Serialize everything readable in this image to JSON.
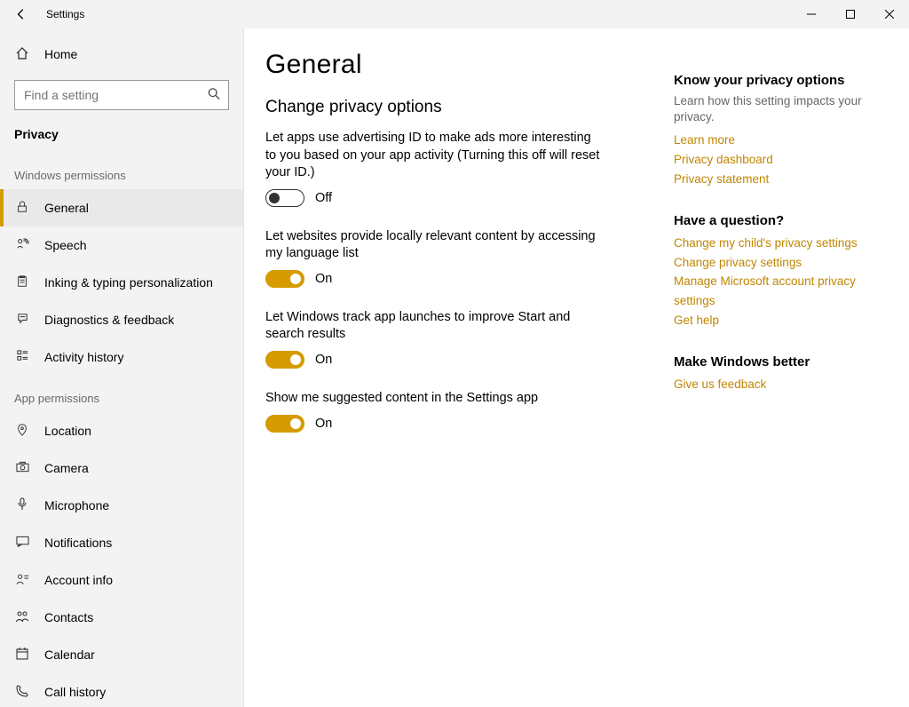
{
  "titlebar": {
    "title": "Settings"
  },
  "sidebar": {
    "home": "Home",
    "search_placeholder": "Find a setting",
    "category": "Privacy",
    "section_win": "Windows permissions",
    "section_app": "App permissions",
    "items_win": [
      {
        "icon": "lock",
        "label": "General"
      },
      {
        "icon": "speech",
        "label": "Speech"
      },
      {
        "icon": "ink",
        "label": "Inking & typing personalization"
      },
      {
        "icon": "diag",
        "label": "Diagnostics & feedback"
      },
      {
        "icon": "history",
        "label": "Activity history"
      }
    ],
    "items_app": [
      {
        "icon": "location",
        "label": "Location"
      },
      {
        "icon": "camera",
        "label": "Camera"
      },
      {
        "icon": "mic",
        "label": "Microphone"
      },
      {
        "icon": "notif",
        "label": "Notifications"
      },
      {
        "icon": "account",
        "label": "Account info"
      },
      {
        "icon": "contacts",
        "label": "Contacts"
      },
      {
        "icon": "calendar",
        "label": "Calendar"
      },
      {
        "icon": "call",
        "label": "Call history"
      }
    ]
  },
  "page": {
    "title": "General",
    "subheading": "Change privacy options",
    "settings": [
      {
        "desc": "Let apps use advertising ID to make ads more interesting to you based on your app activity (Turning this off will reset your ID.)",
        "state": "Off"
      },
      {
        "desc": "Let websites provide locally relevant content by accessing my language list",
        "state": "On"
      },
      {
        "desc": "Let Windows track app launches to improve Start and search results",
        "state": "On"
      },
      {
        "desc": "Show me suggested content in the Settings app",
        "state": "On"
      }
    ]
  },
  "right": {
    "know_title": "Know your privacy options",
    "know_text": "Learn how this setting impacts your privacy.",
    "learn_more": "Learn more",
    "privacy_dashboard": "Privacy dashboard",
    "privacy_statement": "Privacy statement",
    "question_title": "Have a question?",
    "q_links": [
      "Change my child's privacy settings",
      "Change privacy settings",
      "Manage Microsoft account privacy settings",
      "Get help"
    ],
    "better_title": "Make Windows better",
    "give_feedback": "Give us feedback"
  },
  "icons": {
    "home": "⌂",
    "lock": "🔒",
    "speech": "🗣",
    "ink": "📋",
    "diag": "ᚼ",
    "history": "🕓",
    "location": "📍",
    "camera": "📷",
    "mic": "🎤",
    "notif": "💬",
    "account": "👤",
    "contacts": "👥",
    "calendar": "📅",
    "call": "📞",
    "search": "🔍"
  }
}
